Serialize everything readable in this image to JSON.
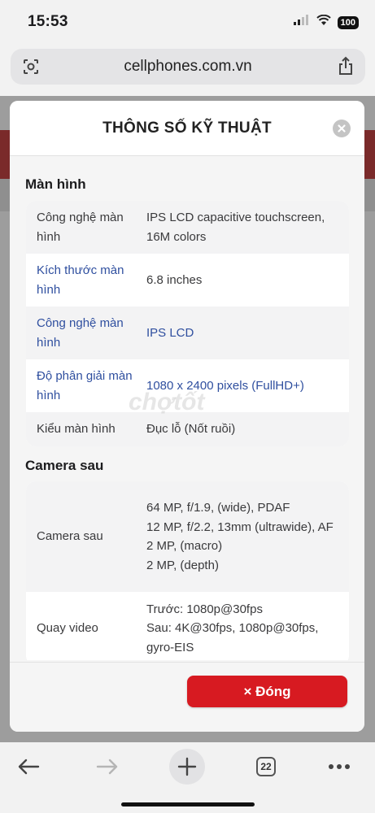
{
  "status_bar": {
    "time": "15:53",
    "battery": "100"
  },
  "browser": {
    "url": "cellphones.com.vn",
    "tabs_count": "22"
  },
  "modal": {
    "title": "THÔNG SỐ KỸ THUẬT",
    "close_label": "× Đóng",
    "sections": [
      {
        "title": "Màn hình",
        "rows": [
          {
            "label": "Công nghệ màn hình",
            "value": "IPS LCD capacitive touchscreen, 16M colors"
          },
          {
            "label": "Kích thước màn hình",
            "value": "6.8 inches"
          },
          {
            "label": "Công nghệ màn hình",
            "value": "IPS LCD"
          },
          {
            "label": "Độ phân giải màn hình",
            "value": "1080 x 2400 pixels (FullHD+)"
          },
          {
            "label": "Kiểu màn hình",
            "value": "Đục lỗ (Nốt ruồi)"
          }
        ]
      },
      {
        "title": "Camera sau",
        "rows": [
          {
            "label": "Camera sau",
            "value_lines": [
              "64 MP, f/1.9, (wide), PDAF",
              "12 MP, f/2.2, 13mm (ultrawide), AF",
              "2 MP, (macro)",
              "2 MP, (depth)"
            ]
          },
          {
            "label": "Quay video",
            "value_lines": [
              "Trước: 1080p@30fps",
              "Sau: 4K@30fps, 1080p@30fps, gyro-EIS"
            ]
          }
        ]
      }
    ]
  },
  "watermark": "chotot",
  "colors": {
    "accent_red": "#d71a21",
    "link_blue": "#2f4f9f"
  }
}
